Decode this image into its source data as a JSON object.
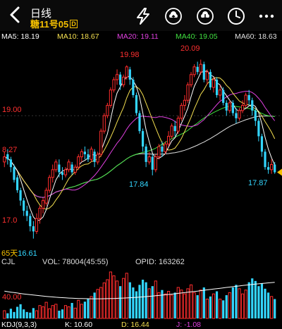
{
  "header": {
    "title": "日线",
    "contract": "糖11号05",
    "contract_badge": "D",
    "icons": [
      "back-arrow-icon",
      "lightning-icon",
      "cloud-upload-icon",
      "cloud-download-icon",
      "clock-icon",
      "more-icon"
    ]
  },
  "ma": {
    "ma5": {
      "label": "MA5: 18.19",
      "color": "#ffffff"
    },
    "ma10": {
      "label": "MA10: 18.67",
      "color": "#f5e050"
    },
    "ma20": {
      "label": "MA20: 19.11",
      "color": "#e040e0"
    },
    "ma40": {
      "label": "MA40: 19.05",
      "color": "#40e040"
    },
    "ma60": {
      "label": "MA60: 18.63",
      "color": "#e0e0e0"
    }
  },
  "price_labels": {
    "high1": "19.98",
    "high2": "20.09",
    "low1": "17.84",
    "low2": "17.87",
    "left_19": "19.00",
    "left_18": "8.27",
    "left_17": "17.0",
    "period_days": "65天",
    "period_low": "16.61"
  },
  "volume_header": {
    "name": "CJL",
    "vol": "VOL: 78004(45:55)",
    "opid": "OPID: 163262",
    "axis": "40.00"
  },
  "kdj": {
    "name": "KDJ(9,3,3)",
    "k": "K: 10.60",
    "d": "D: 16.44",
    "j": "J: -1.08"
  },
  "colors": {
    "up": "#ff2d2d",
    "down": "#33d6ff",
    "accent": "#f5c000"
  },
  "chart_data": {
    "type": "candlestick",
    "ylim": [
      16.4,
      20.4
    ],
    "candles": [
      [
        18.1,
        18.2,
        18.3,
        18.0
      ],
      [
        18.25,
        18.15,
        18.35,
        18.05
      ],
      [
        18.15,
        18.0,
        18.2,
        17.9
      ],
      [
        18.0,
        17.75,
        18.05,
        17.7
      ],
      [
        17.8,
        17.55,
        17.85,
        17.5
      ],
      [
        17.55,
        17.35,
        17.6,
        17.25
      ],
      [
        17.35,
        17.15,
        17.4,
        17.05
      ],
      [
        17.15,
        17.05,
        17.25,
        16.95
      ],
      [
        17.05,
        16.85,
        17.1,
        16.75
      ],
      [
        16.85,
        16.75,
        16.95,
        16.61
      ],
      [
        16.75,
        17.0,
        17.1,
        16.7
      ],
      [
        17.0,
        17.2,
        17.25,
        16.9
      ],
      [
        17.2,
        17.35,
        17.4,
        17.1
      ],
      [
        17.3,
        17.55,
        17.6,
        17.25
      ],
      [
        17.55,
        17.8,
        17.85,
        17.5
      ],
      [
        17.8,
        17.95,
        18.05,
        17.7
      ],
      [
        17.95,
        18.1,
        18.15,
        17.9
      ],
      [
        18.05,
        17.9,
        18.15,
        17.8
      ],
      [
        17.9,
        17.85,
        18.0,
        17.75
      ],
      [
        17.85,
        17.95,
        18.0,
        17.8
      ],
      [
        17.95,
        18.1,
        18.15,
        17.9
      ],
      [
        18.05,
        17.9,
        18.1,
        17.85
      ],
      [
        17.9,
        18.0,
        18.05,
        17.85
      ],
      [
        18.0,
        18.2,
        18.25,
        17.95
      ],
      [
        18.2,
        18.3,
        18.35,
        18.1
      ],
      [
        18.3,
        18.25,
        18.4,
        18.15
      ],
      [
        18.25,
        18.15,
        18.35,
        18.1
      ],
      [
        18.15,
        18.35,
        18.4,
        18.1
      ],
      [
        18.3,
        18.1,
        18.35,
        18.0
      ],
      [
        18.1,
        18.25,
        18.3,
        18.05
      ],
      [
        18.25,
        18.7,
        18.75,
        18.2
      ],
      [
        18.7,
        19.0,
        19.05,
        18.65
      ],
      [
        19.0,
        19.2,
        19.25,
        18.95
      ],
      [
        19.2,
        19.5,
        19.55,
        19.15
      ],
      [
        19.5,
        19.7,
        19.75,
        19.45
      ],
      [
        19.7,
        19.8,
        19.9,
        19.6
      ],
      [
        19.8,
        19.6,
        19.85,
        19.5
      ],
      [
        19.6,
        19.75,
        19.8,
        19.55
      ],
      [
        19.75,
        19.95,
        19.98,
        19.7
      ],
      [
        19.9,
        19.7,
        19.95,
        19.6
      ],
      [
        19.7,
        19.4,
        19.75,
        19.35
      ],
      [
        19.4,
        19.05,
        19.45,
        19.0
      ],
      [
        19.05,
        18.7,
        19.1,
        18.65
      ],
      [
        18.7,
        18.4,
        18.75,
        18.3
      ],
      [
        18.4,
        18.1,
        18.45,
        18.0
      ],
      [
        18.1,
        18.2,
        18.3,
        18.05
      ],
      [
        18.2,
        17.95,
        18.25,
        17.84
      ],
      [
        17.95,
        18.2,
        18.25,
        17.9
      ],
      [
        18.2,
        18.4,
        18.45,
        18.15
      ],
      [
        18.4,
        18.3,
        18.5,
        18.2
      ],
      [
        18.3,
        18.45,
        18.5,
        18.25
      ],
      [
        18.45,
        18.6,
        18.7,
        18.4
      ],
      [
        18.6,
        18.8,
        18.85,
        18.55
      ],
      [
        18.8,
        18.7,
        18.9,
        18.6
      ],
      [
        18.7,
        18.95,
        19.0,
        18.65
      ],
      [
        18.95,
        19.2,
        19.25,
        18.9
      ],
      [
        19.2,
        19.3,
        19.4,
        19.1
      ],
      [
        19.3,
        19.6,
        19.65,
        19.25
      ],
      [
        19.6,
        19.8,
        19.85,
        19.55
      ],
      [
        19.8,
        19.95,
        20.0,
        19.75
      ],
      [
        19.95,
        19.85,
        20.05,
        19.8
      ],
      [
        19.85,
        20.0,
        20.09,
        19.8
      ],
      [
        20.0,
        19.7,
        20.05,
        19.65
      ],
      [
        19.7,
        19.85,
        19.9,
        19.6
      ],
      [
        19.85,
        19.55,
        19.9,
        19.5
      ],
      [
        19.55,
        19.7,
        19.75,
        19.45
      ],
      [
        19.7,
        19.4,
        19.75,
        19.35
      ],
      [
        19.4,
        19.5,
        19.6,
        19.3
      ],
      [
        19.5,
        19.25,
        19.55,
        19.2
      ],
      [
        19.25,
        19.1,
        19.3,
        19.0
      ],
      [
        19.1,
        19.25,
        19.3,
        19.05
      ],
      [
        19.25,
        19.05,
        19.3,
        19.0
      ],
      [
        19.05,
        18.95,
        19.15,
        18.85
      ],
      [
        18.95,
        19.1,
        19.15,
        18.9
      ],
      [
        19.1,
        19.2,
        19.3,
        19.05
      ],
      [
        19.2,
        19.4,
        19.45,
        19.15
      ],
      [
        19.4,
        19.3,
        19.5,
        19.2
      ],
      [
        19.3,
        19.1,
        19.35,
        19.0
      ],
      [
        19.1,
        18.9,
        19.15,
        18.8
      ],
      [
        18.9,
        18.6,
        18.95,
        18.5
      ],
      [
        18.6,
        18.3,
        18.65,
        18.2
      ],
      [
        18.3,
        18.0,
        18.35,
        17.95
      ],
      [
        18.0,
        17.95,
        18.1,
        17.87
      ],
      [
        17.95,
        18.05,
        18.15,
        17.87
      ],
      [
        18.05,
        17.9,
        18.1,
        17.87
      ]
    ],
    "volume": [
      12,
      8,
      15,
      10,
      18,
      22,
      14,
      10,
      9,
      16,
      12,
      20,
      18,
      25,
      15,
      20,
      22,
      12,
      14,
      20,
      18,
      24,
      16,
      28,
      22,
      26,
      30,
      34,
      40,
      45,
      48,
      55,
      60,
      72,
      66,
      58,
      50,
      62,
      70,
      56,
      48,
      42,
      52,
      60,
      56,
      46,
      50,
      58,
      40,
      44,
      38,
      42,
      36,
      40,
      48,
      44,
      38,
      46,
      52,
      40,
      36,
      44,
      48,
      30,
      34,
      38,
      42,
      30,
      28,
      36,
      40,
      48,
      52,
      46,
      38,
      44,
      56,
      62,
      58,
      50,
      54,
      46,
      40,
      34,
      30
    ]
  }
}
